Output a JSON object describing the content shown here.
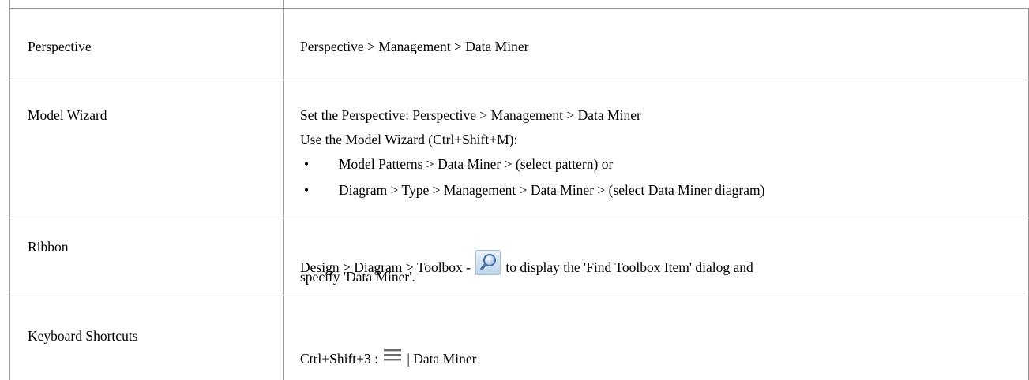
{
  "rows": [
    {
      "label": "Perspective",
      "lines": [
        "Perspective > Management > Data Miner"
      ]
    },
    {
      "label": "Model Wizard",
      "lines": [
        "Set the Perspective: Perspective > Management > Data Miner",
        "Use the Model Wizard (Ctrl+Shift+M):"
      ],
      "bullets": [
        "Model Patterns >  Data Miner > (select pattern) or",
        "Diagram > Type > Management > Data Miner > (select Data Miner diagram)"
      ]
    },
    {
      "label": "Ribbon",
      "line1_before": "Design > Diagram > Toolbox - ",
      "line1_after": "to display the 'Find Toolbox Item' dialog and",
      "line2": "specify 'Data Miner'.",
      "icon": "search-icon"
    },
    {
      "label": "Keyboard Shortcuts",
      "before": "Ctrl+Shift+3 : ",
      "after": "| Data Miner",
      "icon": "menu-icon"
    }
  ],
  "bullet_char": "•"
}
